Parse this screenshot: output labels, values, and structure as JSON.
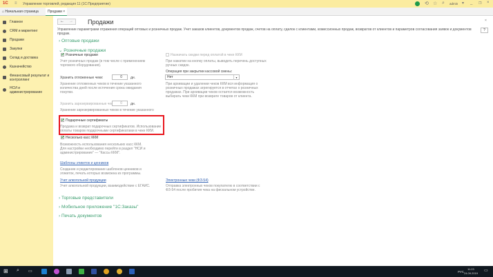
{
  "window": {
    "title": "Управление торговлей, редакция 11  (1С:Предприятие)",
    "user": "admin",
    "logo": "1С"
  },
  "tabs": [
    {
      "label": "Начальная страница"
    },
    {
      "label": "Продажи"
    }
  ],
  "sidebar": {
    "items": [
      {
        "label": "Главное"
      },
      {
        "label": "CRM и маркетинг"
      },
      {
        "label": "Продажи"
      },
      {
        "label": "Закупки"
      },
      {
        "label": "Склад и доставка"
      },
      {
        "label": "Казначейство"
      },
      {
        "label": "Финансовый результат и контроллинг"
      },
      {
        "label": "НСИ и администрирование"
      }
    ]
  },
  "page": {
    "title": "Продажи",
    "description": "Управление параметрами отражения операций оптовых и розничных продаж. Учет заказов клиентов, документов продаж, счетов на оплату, сделок с клиентами, комиссионных продаж, возвратов от клиентов и параметров согласования заявок и документов продаж.",
    "help": "?",
    "wholesale": "Оптовые продажи",
    "retail": "Розничные продажи",
    "retail_chk": "Розничные продажи",
    "retail_desc": "Учет розничных продаж (в том числе с применением торгового оборудования).",
    "keep_deferred": "Хранить отложенные чеки:",
    "keep_deferred_val": "0",
    "days": "дн.",
    "keep_deferred_desc": "Хранение отложенных чеков в течение указанного количества дней после истечения срока ожидания покупки.",
    "keep_reserved": "Хранить зарезервированные чеки:",
    "keep_reserved_val": "0",
    "keep_reserved_desc": "Хранение зарезервированных чеков в течение указанного",
    "gift_chk": "Подарочные сертификаты",
    "gift_desc": "Продажа и возврат подарочных сертификатов. Использование оплаты товаров подарочными сертификатами в чеке ККМ.",
    "multi_chk": "Несколько касс ККМ",
    "multi_desc": "Возможность использования нескольких касс ККМ. Для настройки необходимо перейти в раздел \"НСИ и администрирование\" — \"Кассы ККМ\".",
    "templates_link": "Шаблоны этикеток и ценников",
    "templates_desc": "Создание и редактирование шаблонов ценников и этикеток, печать которых возможна из программы.",
    "alcohol_link": "Учет алкогольной продукции",
    "alcohol_desc": "Учет алкогольной продукции, взаимодействие с ЕГАИС.",
    "discount_chk": "Назначать скидки перед оплатой в чеке ККМ",
    "discount_desc": "При нажатии на кнопку оплаты, выводить перечень доступных ручных скидок.",
    "close_op_label": "Операция при закрытии кассовой смены:",
    "close_op_val": "Нет",
    "close_op_desc": "При архивации и удалении чеков ККМ вся информация о розничных продажах агрегируется в отчетах о розничных продажах. При архивации чеков остается возможность выбирать чеки ККМ при возврате товаров от клиента.",
    "echeck_link": "Электронные чеки (ФЗ-54)",
    "echeck_desc": "Отправка электронных чеков покупателю в соответствии с ФЗ-54 после пробития чека на фискальном устройстве.",
    "agents": "Торговые представители",
    "mobile": "Мобильное приложение \"1С:Заказы\"",
    "print": "Печать документов"
  },
  "taskbar": {
    "time": "11:23",
    "date": "24.09.2019",
    "lang": "РУС"
  },
  "colors": {
    "accent": "#3a9d6e",
    "highlight": "#e8141c"
  }
}
